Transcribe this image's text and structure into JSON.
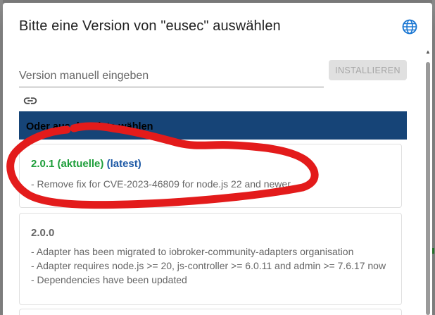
{
  "dialog": {
    "title": "Bitte eine Version von \"eusec\" auswählen",
    "version_input_placeholder": "Version manuell eingeben",
    "install_label": "INSTALLIEREN",
    "list_header": "Oder aus der Liste wählen"
  },
  "versions": [
    {
      "version": "2.0.1",
      "tag_current": "(aktuelle)",
      "tag_latest": "(latest)",
      "changes": [
        "- Remove fix for CVE-2023-46809 for node.js 22 and newer"
      ]
    },
    {
      "version": "2.0.0",
      "changes": [
        "- Adapter has been migrated to iobroker-community-adapters organisation",
        "- Adapter requires node.js >= 20, js-controller >= 6.0.11 and admin >= 7.6.17 now",
        "- Dependencies have been updated"
      ]
    }
  ],
  "colors": {
    "header_bg": "#164477",
    "current_green": "#1e9e3a",
    "latest_blue": "#1e5aa6",
    "annotation_red": "#e31b1b"
  },
  "icons": {
    "language": "globe-icon",
    "link": "link-icon"
  }
}
